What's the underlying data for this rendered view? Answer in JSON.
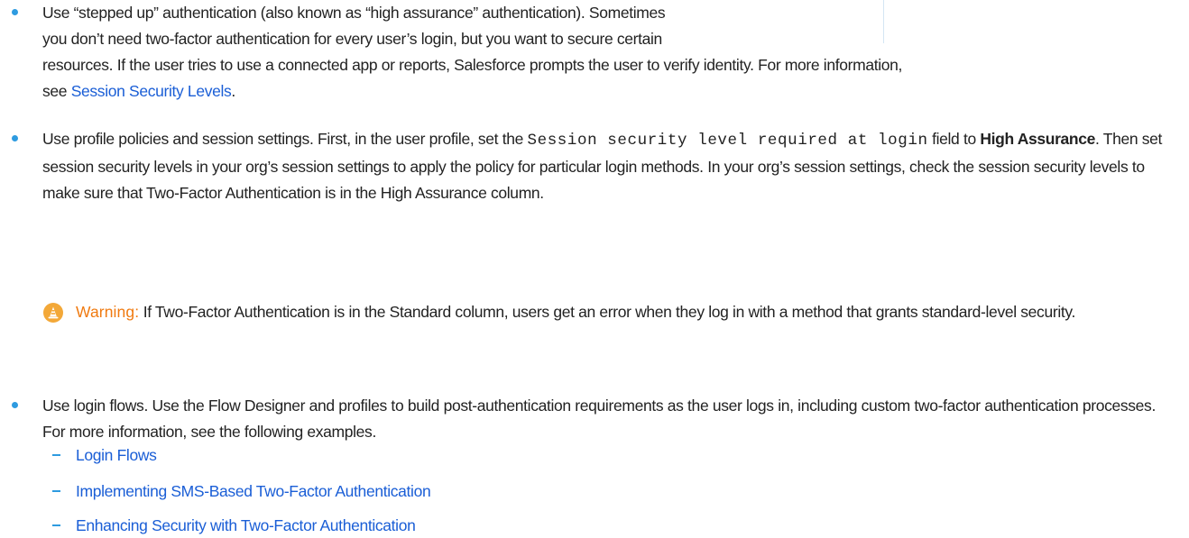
{
  "items": [
    {
      "line1": "Use “stepped up” authentication (also known as “high assurance” authentication). Sometimes",
      "line2": "you don’t need two-factor authentication for every user’s login, but you want to secure certain",
      "line3": "resources. If the user tries to use a connected app or reports, Salesforce prompts the user to verify identity. For more information,",
      "line4_prefix": "see ",
      "link_label": "Session Security Levels",
      "line4_suffix": "."
    },
    {
      "part1": "Use profile policies and session settings. First, in the user profile, set the ",
      "code": "Session security level required at login",
      "part2": " field to ",
      "bold": "High Assurance",
      "part3": ". Then set session security levels in your org’s session settings to apply the policy for particular login methods. In your org’s session settings, check the session security levels to make sure that Two-Factor Authentication is in the High Assurance column."
    },
    {
      "text": "Use login flows. Use the Flow Designer and profiles to build post-authentication requirements as the user logs in, including custom two-factor authentication processes. For more information, see the following examples.",
      "links": [
        "Login Flows",
        "Implementing SMS-Based Two-Factor Authentication",
        "Enhancing Security with Two-Factor Authentication"
      ]
    }
  ],
  "warning": {
    "label": "Warning:",
    "text": "If Two-Factor Authentication is in the Standard column, users get an error when they log in with a method that grants standard-level security."
  },
  "colors": {
    "bullet": "#2e9be0",
    "link": "#1a5ed6",
    "warning_label": "#f07a10",
    "warning_icon": "#f3a838",
    "text": "#222222"
  }
}
